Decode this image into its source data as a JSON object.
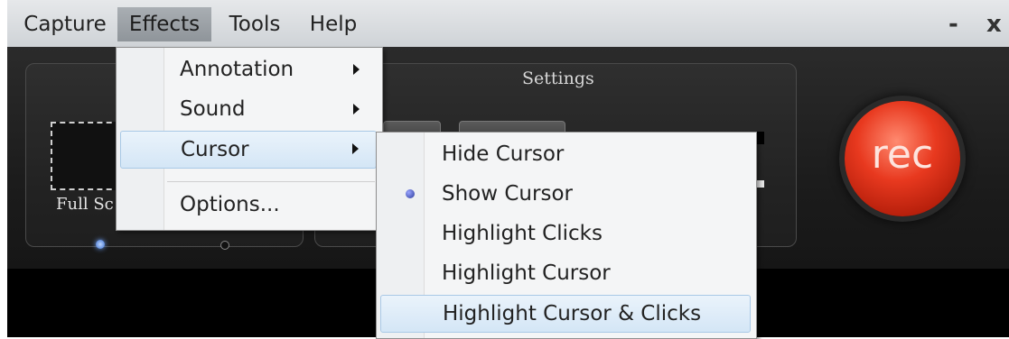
{
  "menubar": {
    "items": [
      "Capture",
      "Effects",
      "Tools",
      "Help"
    ],
    "minimize": "-",
    "close": "x"
  },
  "panel": {
    "settings_title": "Settings",
    "full_screen_label": "Full Sc"
  },
  "rec_button": {
    "label": "rec"
  },
  "effects_menu": {
    "items": [
      "Annotation",
      "Sound",
      "Cursor",
      "Options..."
    ],
    "highlighted": "Cursor"
  },
  "cursor_submenu": {
    "items": [
      "Hide Cursor",
      "Show Cursor",
      "Highlight Clicks",
      "Highlight Cursor",
      "Highlight Cursor & Clicks"
    ],
    "selected": "Show Cursor",
    "highlighted": "Highlight Cursor & Clicks"
  },
  "colors": {
    "menu_highlight": "#d4e6f6",
    "rec_red": "#e8391f",
    "app_background": "#1c1c1c"
  }
}
